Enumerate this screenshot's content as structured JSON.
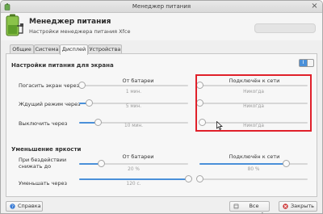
{
  "window": {
    "title": "Менеджер питания",
    "close_glyph": "×"
  },
  "header": {
    "title": "Менеджер питания",
    "subtitle": "Настройки менеджера питания Xfce",
    "icon": "battery-icon"
  },
  "tabs": [
    {
      "label": "Общие",
      "active": false
    },
    {
      "label": "Система",
      "active": false
    },
    {
      "label": "Дисплей",
      "active": true
    },
    {
      "label": "Устройства",
      "active": false
    }
  ],
  "display_section": {
    "title": "Настройки питания для экрана",
    "toggle_label": "I",
    "toggle_on": true,
    "col_battery": "От батареи",
    "col_ac": "Подключён к сети",
    "rows": [
      {
        "label": "Погасить экран через",
        "battery_value": "1 мин.",
        "battery_level": 0.02,
        "ac_value": "Никогда",
        "ac_level": 0.0
      },
      {
        "label": "Ждущий режим через",
        "battery_value": "5 мин.",
        "battery_level": 0.09,
        "ac_value": "Никогда",
        "ac_level": 0.0
      },
      {
        "label": "Выключить через",
        "battery_value": "10 мин.",
        "battery_level": 0.17,
        "ac_value": "Никогда",
        "ac_level": 0.02
      }
    ]
  },
  "brightness_section": {
    "title": "Уменьшение яркости",
    "col_battery": "От батареи",
    "col_ac": "Подключён к сети",
    "rows": [
      {
        "label_line1": "При бездействии",
        "label_line2": "снижать до",
        "battery_value": "20 %",
        "battery_level": 0.2,
        "ac_value": "80 %",
        "ac_level": 0.8
      },
      {
        "label_line1": "Уменьшать через",
        "label_line2": "",
        "battery_value": "120 с.",
        "battery_level": 1.0,
        "ac_value": "",
        "ac_level": 0.0
      }
    ]
  },
  "buttons": {
    "help": "Справка",
    "all_settings": "Все настройки",
    "close": "Закрыть"
  },
  "colors": {
    "accent": "#4a90d9",
    "highlight": "#e0202a"
  }
}
